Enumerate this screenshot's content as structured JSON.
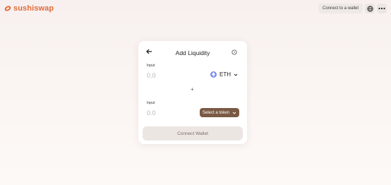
{
  "header": {
    "brand": "sushiswap",
    "connect_label": "Connect to a wallet",
    "globe_icon": "globe-icon",
    "more_icon": "more-horizontal-icon"
  },
  "card": {
    "title": "Add Liquidity",
    "input1": {
      "label": "Input",
      "amount": "0.0",
      "token": "ETH"
    },
    "input2": {
      "label": "Input",
      "amount": "0.0",
      "select_label": "Select a token"
    },
    "plus": "+",
    "connect_wallet": "Connect Wallet"
  },
  "colors": {
    "brand": "#e06c3a",
    "select_token_bg": "#7a5a44",
    "eth": "#7b8bea"
  }
}
